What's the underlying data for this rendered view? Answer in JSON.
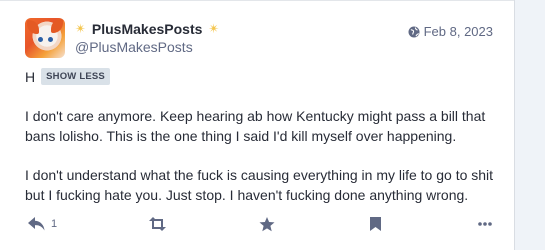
{
  "header": {
    "display_name": "PlusMakesPosts",
    "sparkle": "✴",
    "username": "@PlusMakesPosts",
    "date": "Feb 8, 2023"
  },
  "content_warning": {
    "text": "H",
    "toggle_label": "SHOW LESS"
  },
  "body": {
    "paragraphs": [
      "I don't care anymore. Keep hearing ab how Kentucky might pass a bill that bans lolisho. This is the one thing I said I'd kill myself over happening.",
      "I don't understand what the fuck is causing everything in my life to go to shit but I fucking hate you. Just stop. I haven't fucking done anything wrong."
    ]
  },
  "actions": {
    "reply_count": "1",
    "icons": [
      "reply-icon",
      "boost-icon",
      "star-icon",
      "bookmark-icon",
      "more-icon",
      "globe-icon"
    ]
  },
  "colors": {
    "text": "#282c37",
    "muted": "#606984",
    "badge_bg": "#d9e1e8",
    "sparkle": "#f4c64e",
    "page_bg": "#eff3f8"
  }
}
